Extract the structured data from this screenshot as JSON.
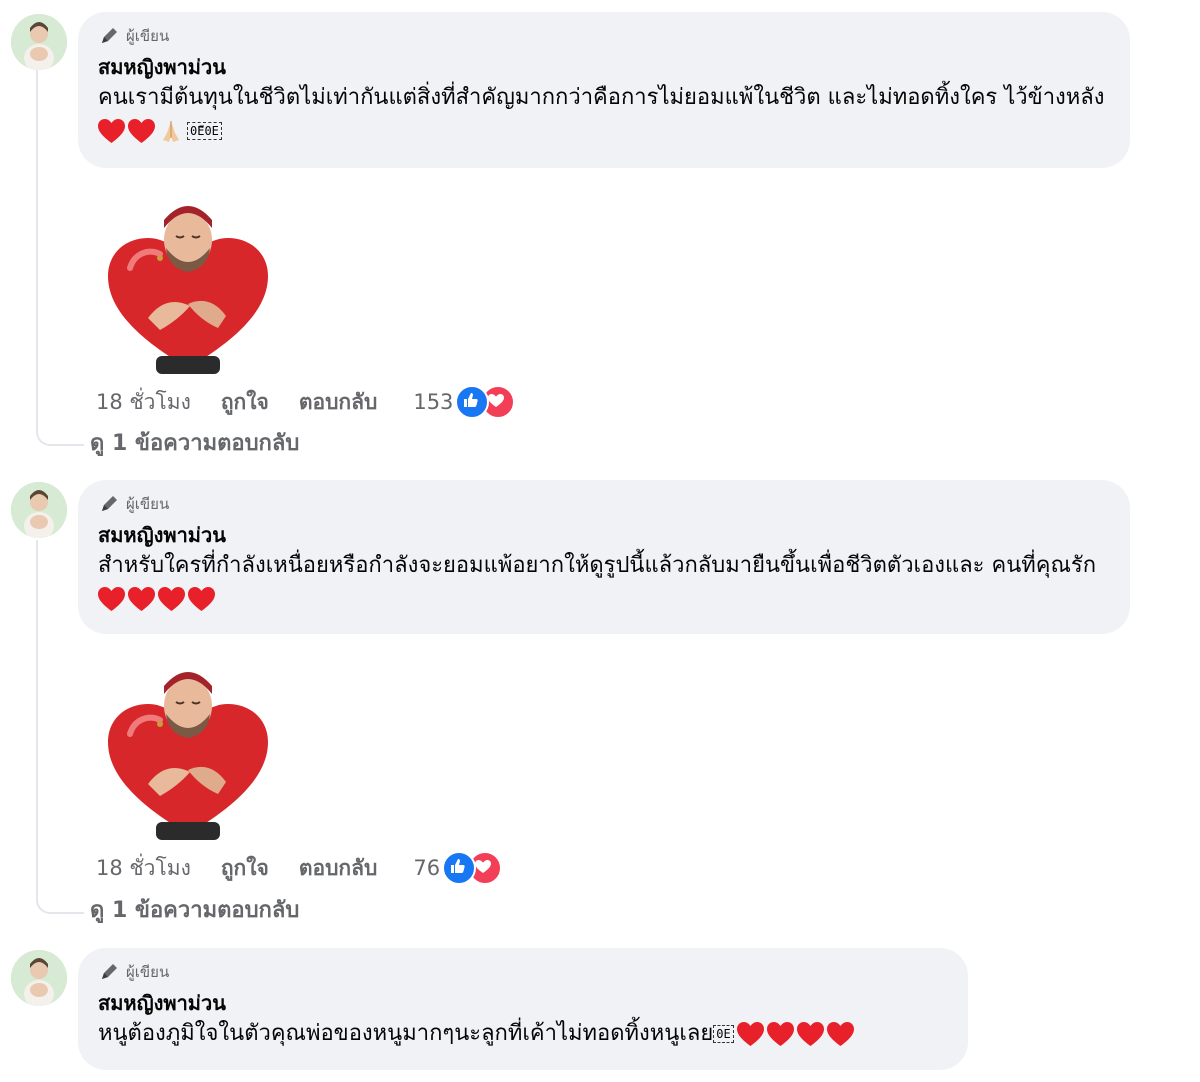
{
  "author_badge": "ผู้เขียน",
  "comments": [
    {
      "author": "สมหญิงพาม่วน",
      "text": "คนเรามีต้นทุนในชีวิตไม่เท่ากันแต่สิ่งที่สำคัญมากกว่าคือการไม่ยอมแพ้ในชีวิต และไม่ทอดทิ้งใคร ไว้ข้างหลัง",
      "glyph_box": "0Eี0E",
      "time": "18 ชั่วโมง",
      "like_label": "ถูกใจ",
      "reply_label": "ตอบกลับ",
      "reaction_count": "153",
      "view_replies": "ดู 1 ข้อความตอบกลับ"
    },
    {
      "author": "สมหญิงพาม่วน",
      "text": "สำหรับใครที่กำลังเหนื่อยหรือกำลังจะยอมแพ้อยากให้ดูรูปนี้แล้วกลับมายืนขึ้นเพื่อชีวิตตัวเองและ คนที่คุณรัก",
      "time": "18 ชั่วโมง",
      "like_label": "ถูกใจ",
      "reply_label": "ตอบกลับ",
      "reaction_count": "76",
      "view_replies": "ดู 1 ข้อความตอบกลับ"
    },
    {
      "author": "สมหญิงพาม่วน",
      "text": "หนูต้องภูมิใจในตัวคุณพ่อของหนูมากๆนะลูกที่เค้าไม่ทอดทิ้งหนูเลย",
      "glyph_box": "0E"
    }
  ],
  "colors": {
    "bubble": "#f0f2f5",
    "meta_text": "#65676b",
    "like_blue": "#1877f2",
    "love_red": "#f33e58",
    "heart": "#e8202a"
  },
  "icons": [
    "pencil-badge-icon",
    "red-heart-icon",
    "praying-hands-icon",
    "like-reaction-icon",
    "love-reaction-icon"
  ]
}
